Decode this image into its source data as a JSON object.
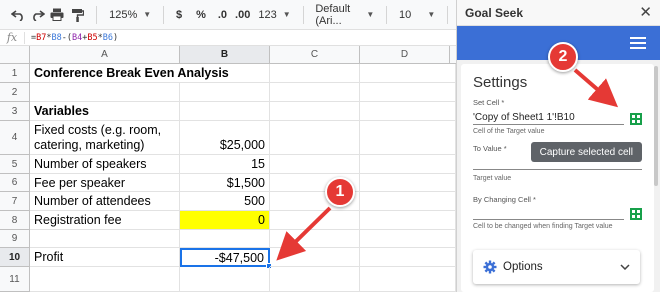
{
  "toolbar": {
    "zoom": "125%",
    "currency": "$",
    "percent": "%",
    "dec_decrease": ".0",
    "dec_increase": ".00",
    "number_format": "123",
    "font": "Default (Ari...",
    "font_size": "10"
  },
  "formula_bar": {
    "fx": "fx",
    "formula_parts": [
      "=",
      "B7",
      "*",
      "B8",
      "-(",
      "B4",
      "+",
      "B5",
      "*",
      "B6",
      ")"
    ]
  },
  "sheet": {
    "columns": [
      "A",
      "B",
      "C",
      "D"
    ],
    "rows": [
      {
        "num": "1",
        "a": "Conference Break Even Analysis",
        "b": ""
      },
      {
        "num": "2",
        "a": "",
        "b": ""
      },
      {
        "num": "3",
        "a": "Variables",
        "b": ""
      },
      {
        "num": "4",
        "a": "Fixed costs (e.g. room, catering, marketing)",
        "b": "$25,000"
      },
      {
        "num": "5",
        "a": "Number of speakers",
        "b": "15"
      },
      {
        "num": "6",
        "a": "Fee per speaker",
        "b": "$1,500"
      },
      {
        "num": "7",
        "a": "Number of attendees",
        "b": "500"
      },
      {
        "num": "8",
        "a": "Registration fee",
        "b": "0"
      },
      {
        "num": "9",
        "a": "",
        "b": ""
      },
      {
        "num": "10",
        "a": "Profit",
        "b": "-$47,500"
      },
      {
        "num": "11",
        "a": "",
        "b": ""
      }
    ],
    "highlight_color": "#ffff00",
    "selection_color": "#1a73e8"
  },
  "panel": {
    "title": "Goal Seek",
    "close": "✕",
    "heading": "Settings",
    "set_cell_label": "Set Cell *",
    "set_cell_value": "'Copy of Sheet1 1'!B10",
    "set_cell_hint": "Cell of the Target value",
    "to_value_label": "To Value *",
    "capture_button": "Capture selected cell",
    "target_hint": "Target value",
    "changing_label": "By Changing Cell *",
    "changing_hint": "Cell to be changed when finding Target value",
    "options_label": "Options",
    "accent_color": "#3b6fd6"
  },
  "callouts": [
    "1",
    "2"
  ]
}
